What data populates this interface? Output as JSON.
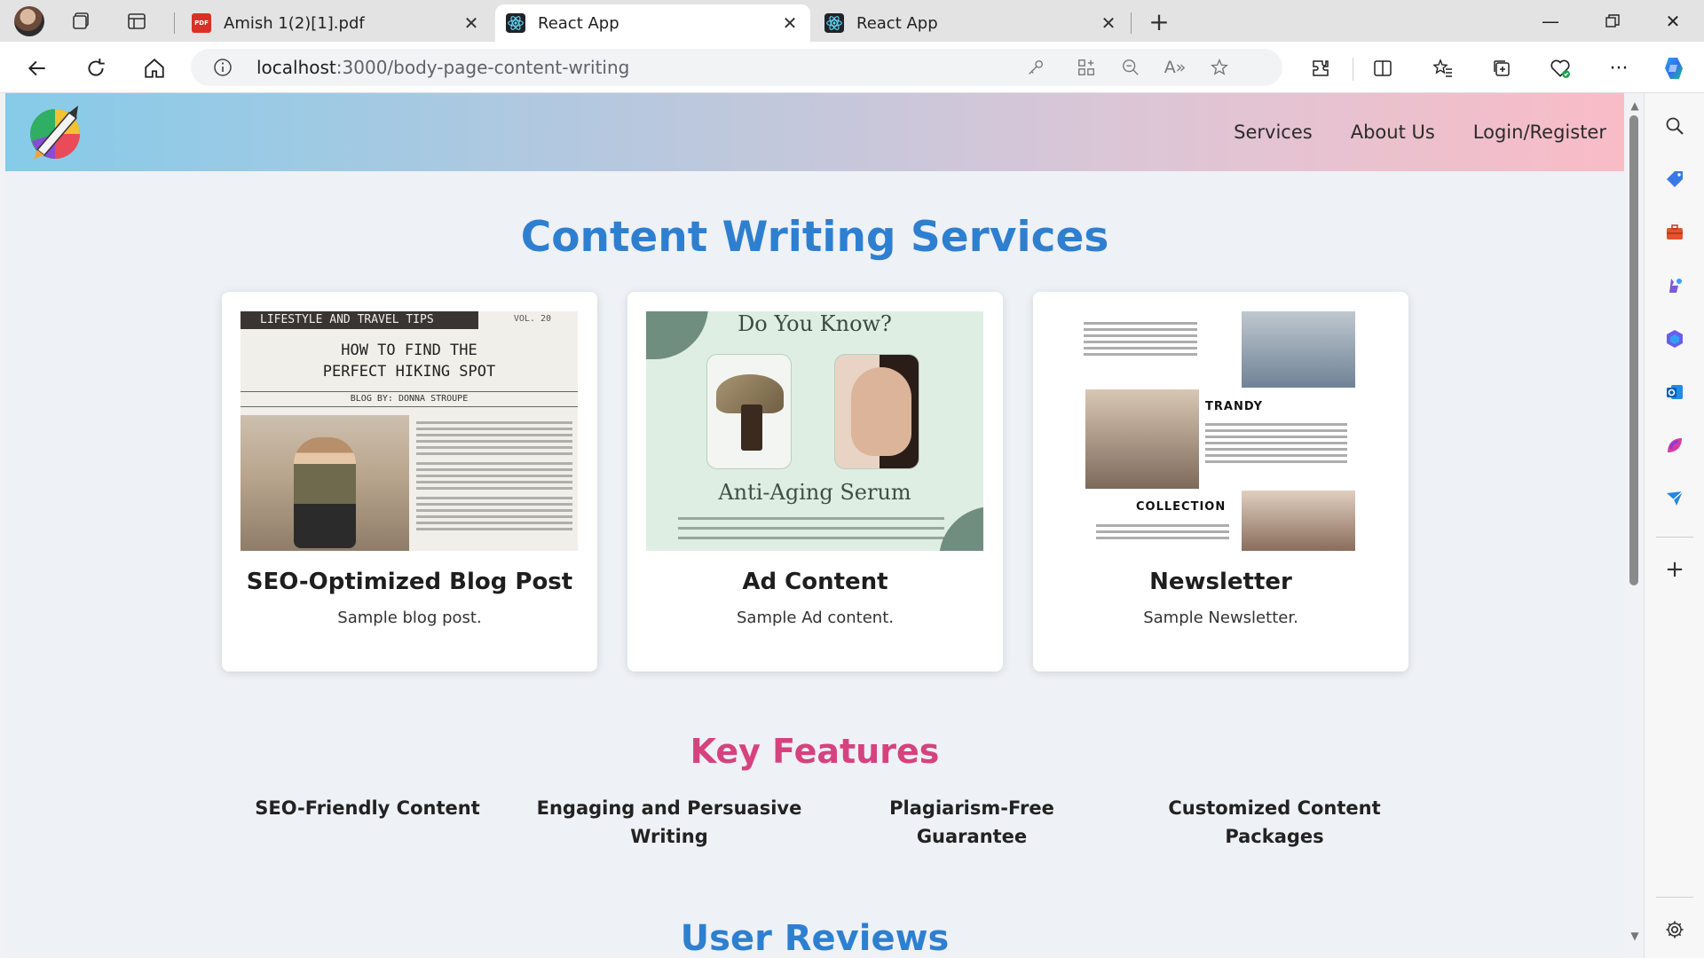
{
  "browser": {
    "tabs": [
      {
        "title": "Amish 1(2)[1].pdf",
        "favicon": "pdf-icon",
        "active": false
      },
      {
        "title": "React App",
        "favicon": "react-icon",
        "active": true
      },
      {
        "title": "React App",
        "favicon": "react-icon",
        "active": false
      }
    ],
    "pdf_favicon_text": "PDF",
    "url_host": "localhost",
    "url_path": ":3000/body-page-content-writing",
    "accent_color": "#2e7fd0"
  },
  "site": {
    "nav": [
      "Services",
      "About Us",
      "Login/Register"
    ],
    "page_title": "Content Writing Services",
    "cards": [
      {
        "title": "SEO-Optimized Blog Post",
        "text": "Sample blog post."
      },
      {
        "title": "Ad Content",
        "text": "Sample Ad content."
      },
      {
        "title": "Newsletter",
        "text": "Sample Newsletter."
      }
    ],
    "key_features_title": "Key Features",
    "features": [
      "SEO-Friendly Content",
      "Engaging and Persuasive Writing",
      "Plagiarism-Free Guarantee",
      "Customized Content Packages"
    ],
    "user_reviews_title": "User Reviews",
    "title_color": "#2e7fd0",
    "features_color": "#d6427f"
  },
  "images": {
    "blog": {
      "banner": "LIFESTYLE AND TRAVEL TIPS",
      "vol": "VOL. 20",
      "headline_1": "HOW TO FIND THE",
      "headline_2": "PERFECT HIKING SPOT",
      "byline": "BLOG BY: DONNA STROUPE"
    },
    "ad": {
      "heading": "Do You Know?",
      "sub": "Anti-Aging Serum"
    },
    "newsletter": {
      "label_1": "TRANDY",
      "label_2": "COLLECTION"
    }
  }
}
